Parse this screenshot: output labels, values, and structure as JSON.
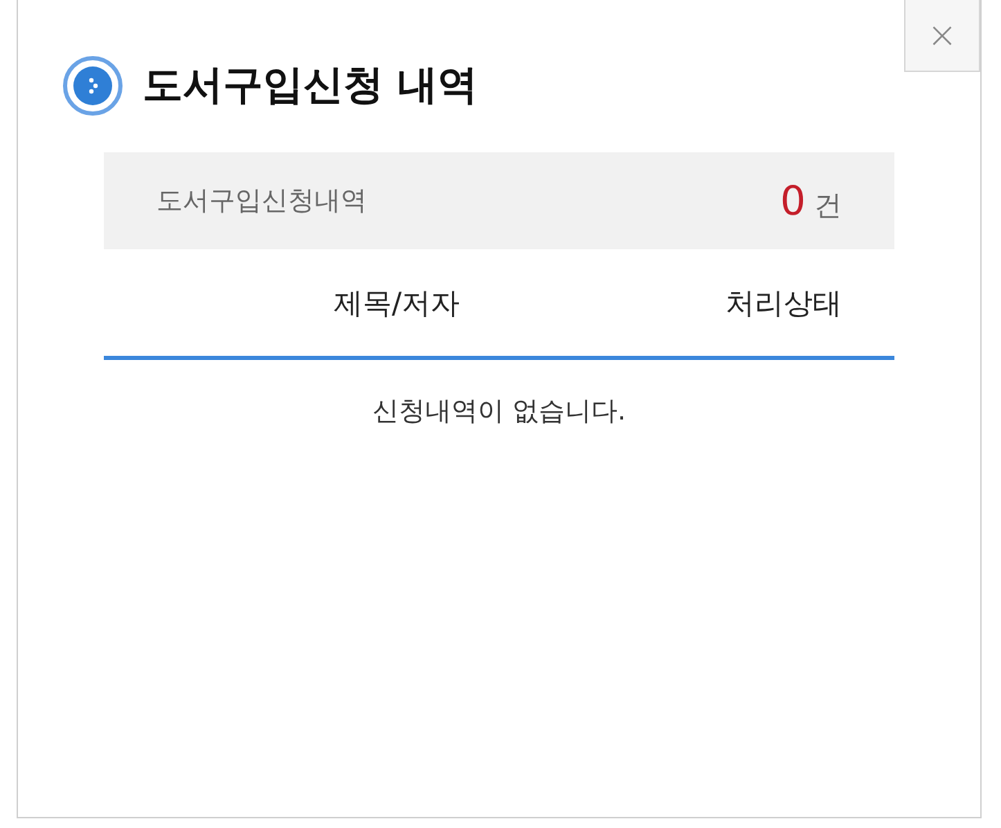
{
  "close_button": {
    "label": "×"
  },
  "title": "도서구입신청 내역",
  "summary": {
    "label": "도서구입신청내역",
    "count": "0",
    "unit": "건"
  },
  "table": {
    "columns": [
      "제목/저자",
      "처리상태"
    ],
    "empty_message": "신청내역이 없습니다."
  }
}
